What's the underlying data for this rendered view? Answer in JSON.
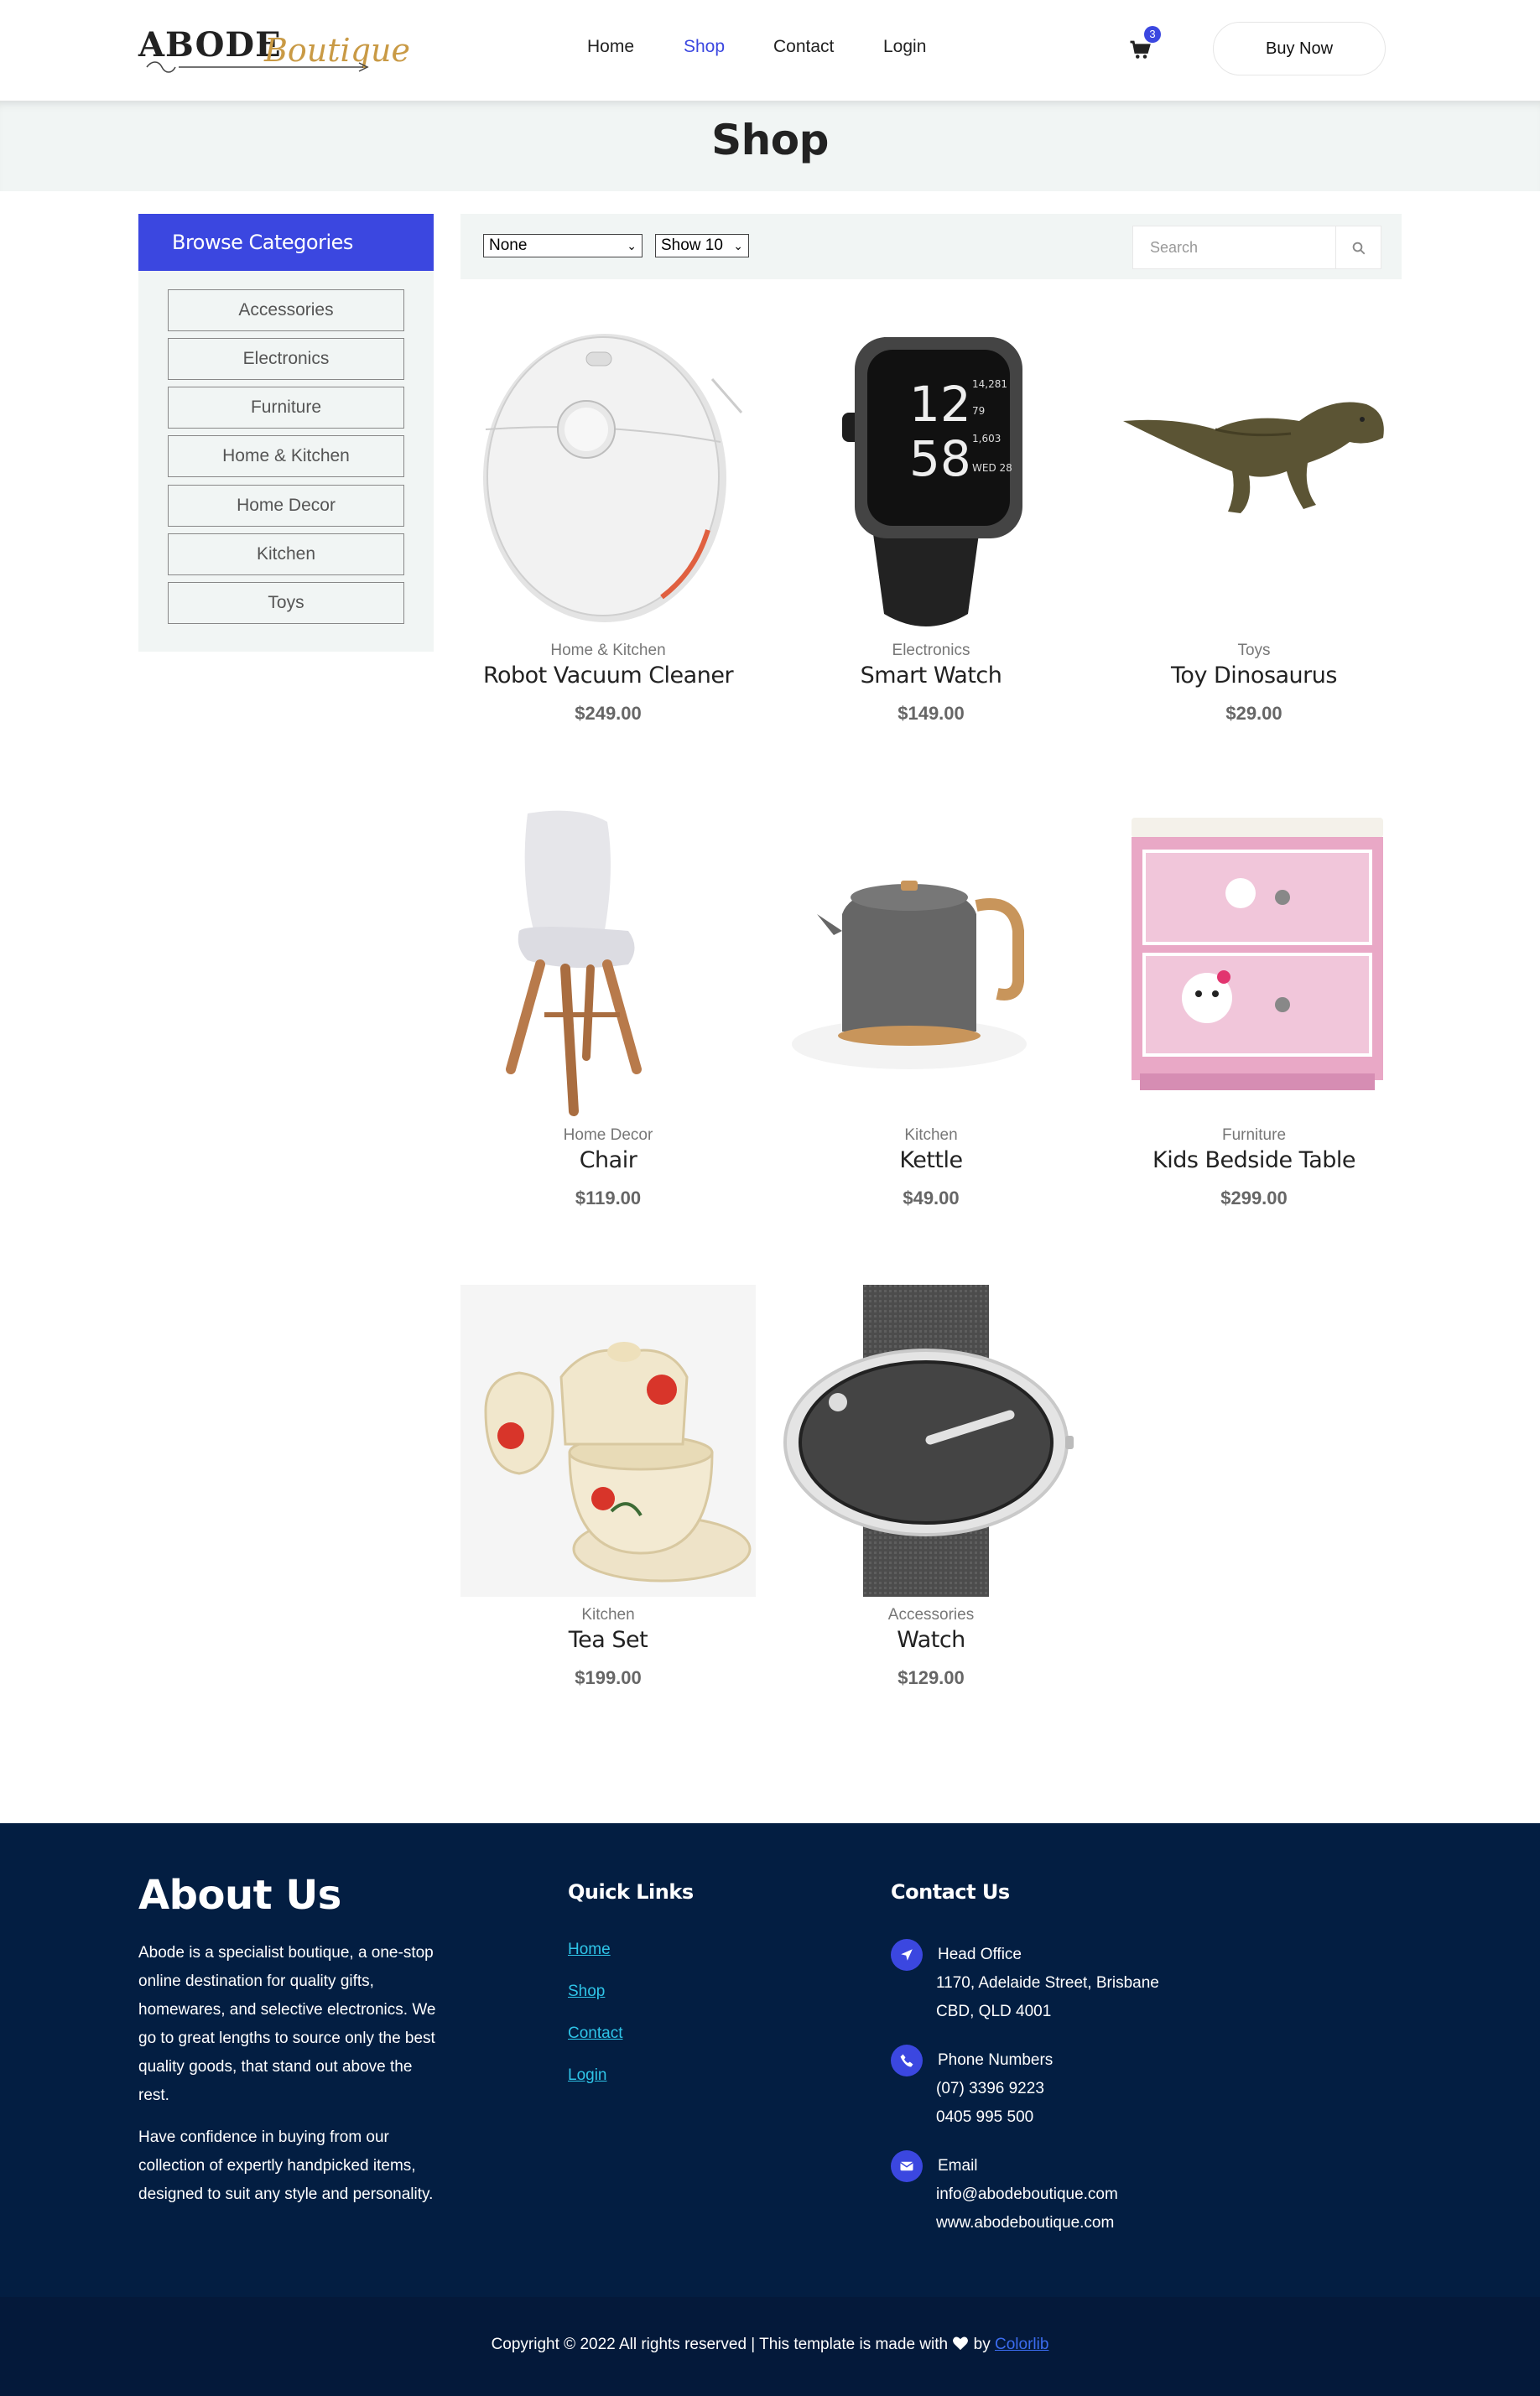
{
  "header": {
    "logo_main": "ABODE",
    "logo_script": "Boutique",
    "nav": [
      {
        "label": "Home",
        "active": false
      },
      {
        "label": "Shop",
        "active": true
      },
      {
        "label": "Contact",
        "active": false
      },
      {
        "label": "Login",
        "active": false
      }
    ],
    "cart_count": "3",
    "buy_now_label": "Buy Now"
  },
  "page_title": "Shop",
  "sidebar": {
    "heading": "Browse Categories",
    "categories": [
      "Accessories",
      "Electronics",
      "Furniture",
      "Home & Kitchen",
      "Home Decor",
      "Kitchen",
      "Toys"
    ]
  },
  "toolbar": {
    "sort_value": "None",
    "show_value": "Show 10",
    "search_placeholder": "Search"
  },
  "products": [
    {
      "category": "Home & Kitchen",
      "name": "Robot Vacuum Cleaner",
      "price": "$249.00",
      "image": "robot-vacuum"
    },
    {
      "category": "Electronics",
      "name": "Smart Watch",
      "price": "$149.00",
      "image": "smart-watch"
    },
    {
      "category": "Toys",
      "name": "Toy Dinosaurus",
      "price": "$29.00",
      "image": "toy-dinosaur"
    },
    {
      "category": "Home Decor",
      "name": "Chair",
      "price": "$119.00",
      "image": "chair"
    },
    {
      "category": "Kitchen",
      "name": "Kettle",
      "price": "$49.00",
      "image": "kettle"
    },
    {
      "category": "Furniture",
      "name": "Kids Bedside Table",
      "price": "$299.00",
      "image": "bedside-table"
    },
    {
      "category": "Kitchen",
      "name": "Tea Set",
      "price": "$199.00",
      "image": "tea-set"
    },
    {
      "category": "Accessories",
      "name": "Watch",
      "price": "$129.00",
      "image": "watch"
    }
  ],
  "smart_watch_screen": {
    "hour": "12",
    "minute": "58",
    "stat1": "14,281",
    "stat2": "79",
    "stat3": "1,603",
    "date": "WED 28"
  },
  "footer": {
    "about": {
      "title": "About Us",
      "p1": "Abode is a specialist boutique, a one-stop online destination for quality gifts, homewares, and selective electronics. We go to great lengths to source only the best quality goods, that stand out above the rest.",
      "p2": "Have confidence in buying from our collection of expertly handpicked items, designed to suit any style and personality."
    },
    "quick_links": {
      "title": "Quick Links",
      "links": [
        "Home",
        "Shop",
        "Contact",
        "Login"
      ]
    },
    "contact": {
      "title": "Contact Us",
      "head_office_label": "Head Office",
      "address_line1": "1170, Adelaide Street, Brisbane",
      "address_line2": "CBD, QLD 4001",
      "phone_label": "Phone Numbers",
      "phone1": "(07) 3396 9223",
      "phone2": "0405 995 500",
      "email_label": "Email",
      "email": "info@abodeboutique.com",
      "website": "www.abodeboutique.com"
    },
    "copyright_text": "Copyright © 2022 All rights reserved | This template is made with",
    "copyright_by": "by",
    "copyright_link": "Colorlib"
  },
  "colors": {
    "accent": "#3b47e0",
    "footer_bg": "#031e42",
    "band_bg": "#f1f5f4",
    "link": "#2fc5e8"
  }
}
